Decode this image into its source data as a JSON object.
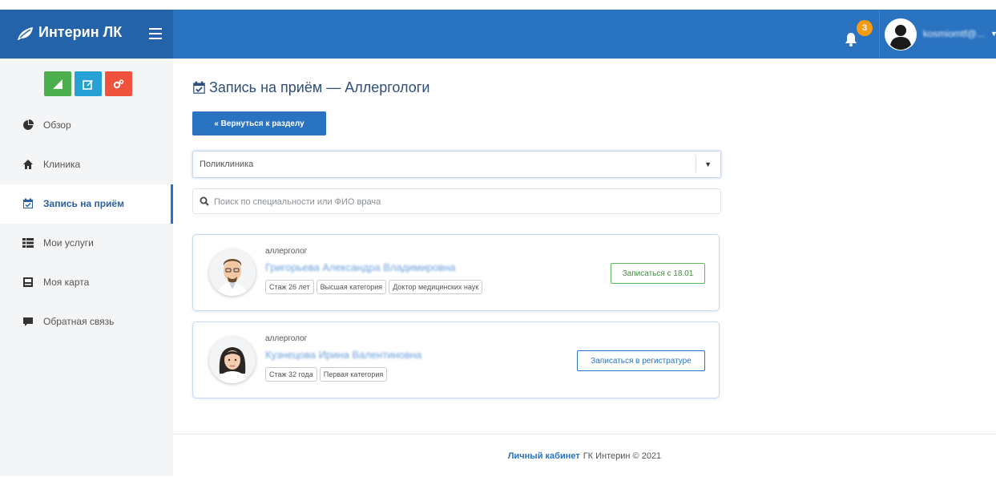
{
  "header": {
    "brand": "Интерин ЛК",
    "notifications_count": "3",
    "username": "kosmiomtf@..."
  },
  "sidebar": {
    "quick_buttons": [
      {
        "icon": "signal-icon",
        "color": "#4cae4c"
      },
      {
        "icon": "edit-icon",
        "color": "#27a0d5"
      },
      {
        "icon": "cogs-icon",
        "color": "#f0533d"
      }
    ],
    "items": [
      {
        "label": "Обзор",
        "icon": "dashboard-icon"
      },
      {
        "label": "Клиника",
        "icon": "home-icon"
      },
      {
        "label": "Запись на приём",
        "icon": "calendar-check-icon",
        "active": true
      },
      {
        "label": "Мои услуги",
        "icon": "list-icon"
      },
      {
        "label": "Моя карта",
        "icon": "card-icon"
      },
      {
        "label": "Обратная связь",
        "icon": "comment-icon"
      }
    ]
  },
  "main": {
    "title": "Запись на приём — Аллергологи",
    "back_button": "« Вернуться к разделу",
    "select_value": "Поликлиника",
    "search_placeholder": "Поиск по специальности или ФИО врача",
    "doctors": [
      {
        "specialty": "аллерголог",
        "name": "Григорьева Александра Владимировна",
        "tags": [
          "Стаж 26 лет",
          "Высшая категория",
          "Доктор медицинских наук"
        ],
        "action": "Записаться с 18.01"
      },
      {
        "specialty": "аллерголог",
        "name": "Кузнецова Ирина Валентиновна",
        "tags": [
          "Стаж 32 года",
          "Первая категория"
        ],
        "action": "Записаться в регистратуре"
      }
    ]
  },
  "footer": {
    "link": "Личный кабинет",
    "text": "ГК Интерин © 2021"
  },
  "colors": {
    "header": "#2a73c1",
    "brand_bg": "#2463aa",
    "sidebar_bg": "#f4f5f7",
    "accent": "#2a73c1",
    "badge": "#f39c12"
  }
}
